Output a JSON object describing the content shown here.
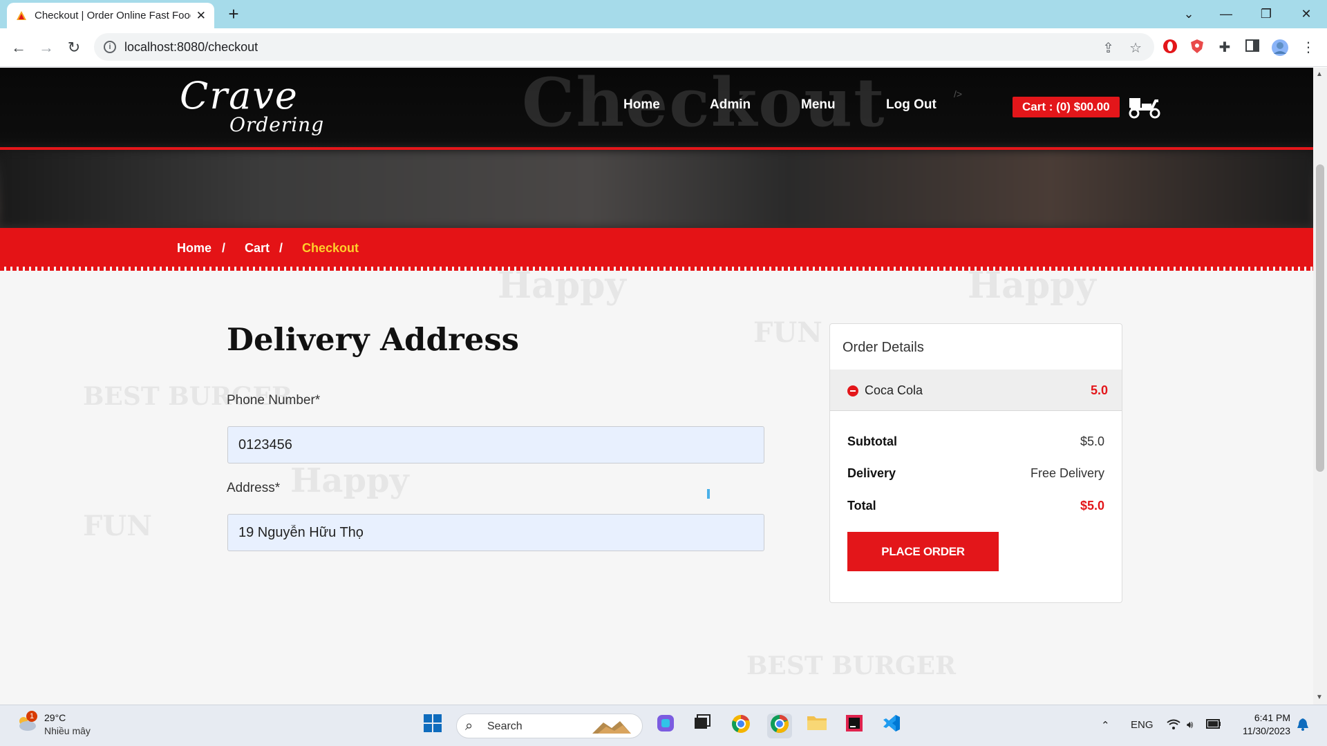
{
  "browser": {
    "tab_title": "Checkout | Order Online Fast Food",
    "url": "localhost:8080/checkout"
  },
  "header": {
    "bg_title": "Checkout",
    "logo_line1": "Crave",
    "logo_line2": "Ordering",
    "nav": [
      "Home",
      "Admin",
      "Menu",
      "Log Out"
    ],
    "code_fragment": "/>",
    "cart_label": "Cart : (0) $00.00"
  },
  "breadcrumb": {
    "items": [
      "Home",
      "Cart",
      "Checkout"
    ],
    "separator": "/"
  },
  "form": {
    "title": "Delivery Address",
    "phone_label": "Phone Number*",
    "phone_value": "0123456",
    "address_label": "Address*",
    "address_value": "19 Nguyễn Hữu Thọ"
  },
  "order": {
    "title": "Order Details",
    "items": [
      {
        "name": "Coca Cola",
        "qty": "5.0"
      }
    ],
    "subtotal_label": "Subtotal",
    "subtotal_value": "$5.0",
    "delivery_label": "Delivery",
    "delivery_value": "Free Delivery",
    "total_label": "Total",
    "total_value": "$5.0",
    "place_order_label": "PLACE ORDER"
  },
  "taskbar": {
    "temperature": "29°C",
    "weather_desc": "Nhiều mây",
    "weather_badge": "1",
    "search_label": "Search",
    "lang": "ENG",
    "time": "6:41 PM",
    "date": "11/30/2023"
  },
  "colors": {
    "brand_red": "#e3161a",
    "breadcrumb_active": "#ffcf2b",
    "input_bg": "#e8f0fe"
  }
}
